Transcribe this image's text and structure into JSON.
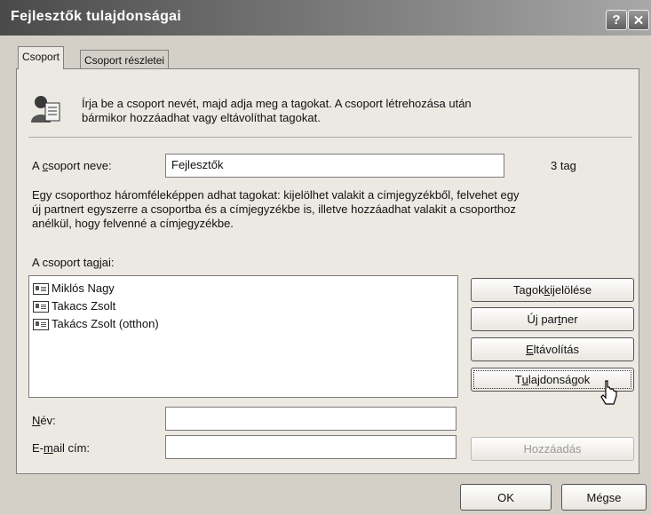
{
  "window": {
    "title": "Fejlesztők tulajdonságai",
    "help_button": "?",
    "close_button": "✕"
  },
  "tabs": [
    {
      "label": "Csoport",
      "active": true
    },
    {
      "label": "Csoport részletei",
      "active": false
    }
  ],
  "intro": {
    "text_line1": "Írja be a csoport nevét, majd adja meg a tagokat. A csoport létrehozása után",
    "text_line2": "bármikor hozzáadhat vagy eltávolíthat tagokat."
  },
  "group_name": {
    "label_prefix": "A ",
    "label_ul": "c",
    "label_suffix": "soport neve:",
    "value": "Fejlesztők",
    "member_count": "3 tag"
  },
  "description": {
    "line1": "Egy csoporthoz háromféleképpen adhat tagokat: kijelölhet valakit a címjegyzékből, felvehet egy",
    "line2": "új partnert egyszerre a csoportba és a címjegyzékbe is, illetve hozzáadhat valakit a csoporthoz",
    "line3": "anélkül, hogy felvenné a címjegyzékbe."
  },
  "members": {
    "label": "A csoport tagjai:",
    "items": [
      "Miklós Nagy",
      "Takacs Zsolt",
      "Takács Zsolt (otthon)"
    ]
  },
  "buttons": {
    "select_members": {
      "pre": "Tagok ",
      "ul": "k",
      "post": "ijelölése"
    },
    "new_contact": {
      "pre": "Új par",
      "ul": "t",
      "post": "ner"
    },
    "remove": {
      "pre": "",
      "ul": "E",
      "post": "ltávolítás"
    },
    "properties": {
      "pre": "T",
      "ul": "u",
      "post": "lajdonságok"
    },
    "add": "Hozzáadás",
    "ok": "OK",
    "cancel": "Mégse"
  },
  "fields": {
    "name": {
      "ul": "N",
      "post": "év:",
      "value": ""
    },
    "email": {
      "pre": "E-",
      "ul": "m",
      "post": "ail cím:",
      "value": ""
    }
  },
  "icons": {
    "group": "group-people-icon",
    "contact": "contact-card-icon",
    "cursor": "mouse-pointer-icon"
  }
}
